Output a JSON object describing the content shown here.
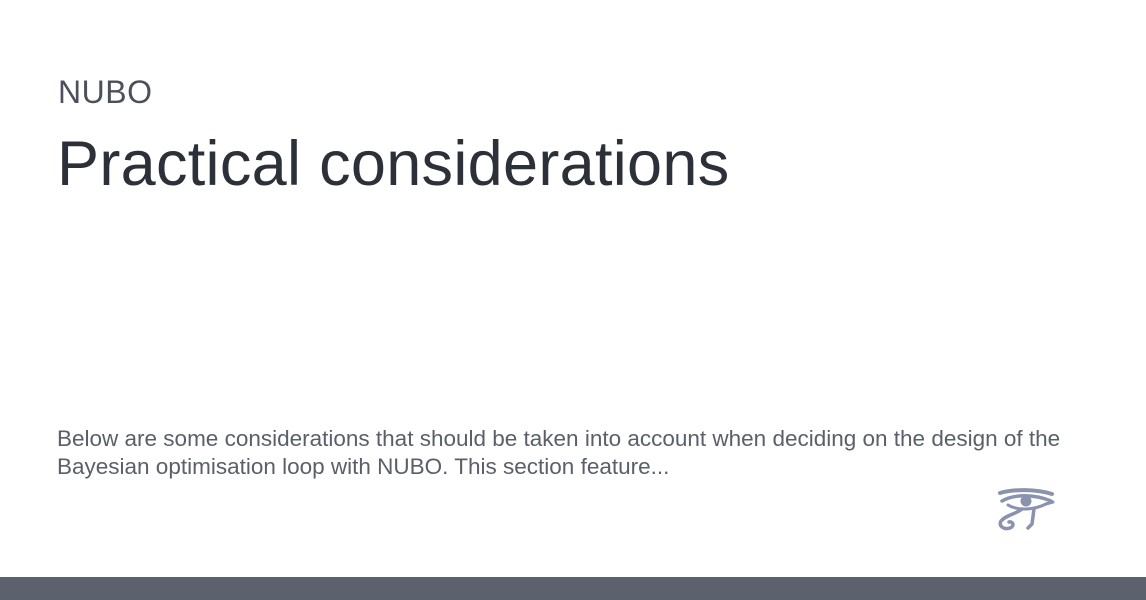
{
  "site": {
    "name": "NUBO"
  },
  "page": {
    "title": "Practical considerations",
    "description": "Below are some considerations that should be taken into account when deciding on the design of the Bayesian optimisation loop with NUBO. This section feature..."
  },
  "logo": {
    "icon": "eye-of-horus-icon",
    "color": "#8a93ad"
  },
  "footer": {
    "color": "#5c626d"
  }
}
